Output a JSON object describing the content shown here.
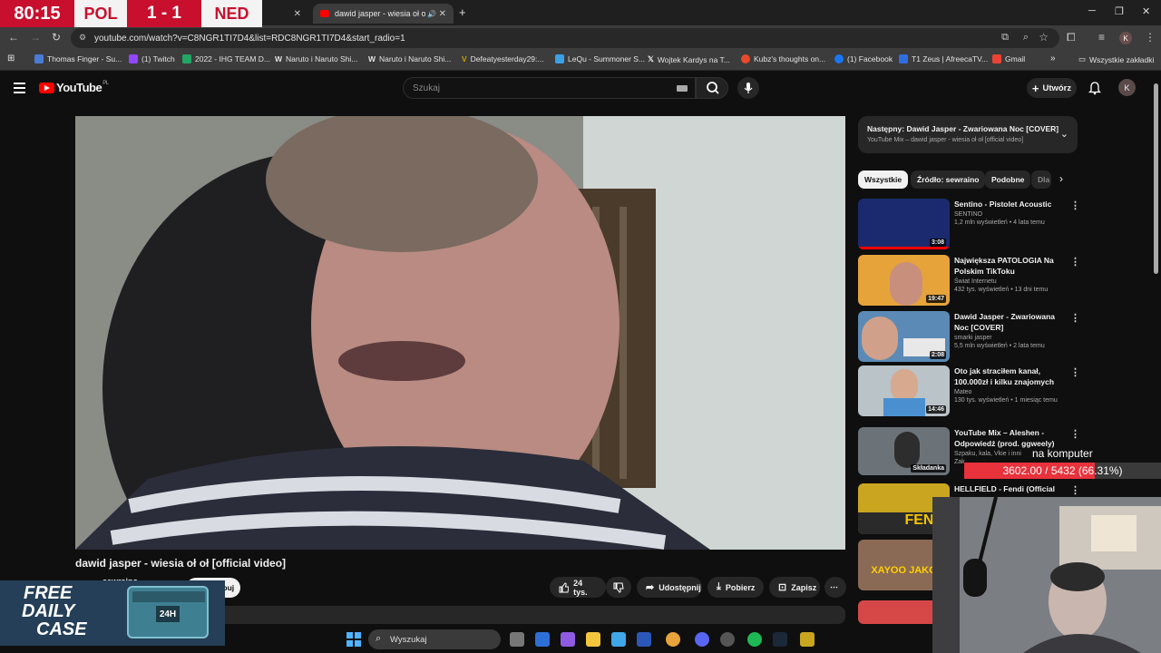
{
  "scoreboard": {
    "time": "80:15",
    "team1": "POL",
    "score": "1 - 1",
    "team2": "NED"
  },
  "browser": {
    "active_tab_title": "dawid jasper - wiesia oł oł |",
    "new_tab_label": "+",
    "url": "youtube.com/watch?v=C8NGR1TI7D4&list=RDC8NGR1TI7D4&start_radio=1",
    "bookmarks": [
      {
        "label": "Thomas Finger - Su...",
        "color": "#4a7bd6"
      },
      {
        "label": "(1) Twitch",
        "color": "#9146ff"
      },
      {
        "label": "2022 - IHG TEAM D...",
        "color": "#23a566"
      },
      {
        "label": "Naruto i Naruto Shi...",
        "color": "#ffffff"
      },
      {
        "label": "Naruto i Naruto Shi...",
        "color": "#ffffff"
      },
      {
        "label": "Defeatyesterday29:...",
        "color": "#c8a200"
      },
      {
        "label": "LeQu - Summoner S...",
        "color": "#3aa0e8"
      },
      {
        "label": "Wojtek Kardys na T...",
        "color": "#111111"
      },
      {
        "label": "Kubz's thoughts on...",
        "color": "#e84a2a"
      },
      {
        "label": "(1) Facebook",
        "color": "#1877f2"
      },
      {
        "label": "T1 Zeus | AfreecaTV...",
        "color": "#2f6ee0"
      },
      {
        "label": "Gmail",
        "color": "#ea4335"
      }
    ],
    "all_bookmarks_label": "Wszystkie zakładki"
  },
  "youtube": {
    "logo_text": "YouTube",
    "logo_region": "PL",
    "search_placeholder": "Szukaj",
    "create_label": "Utwórz",
    "avatar_letter": "K",
    "video_title": "dawid jasper - wiesia oł oł [official video]",
    "channel_name": "sewraino",
    "subscribe_label": "Subskrybuj",
    "actions": {
      "like_count": "24 tys.",
      "share": "Udostępnij",
      "download": "Pobierz",
      "save": "Zapisz"
    },
    "up_next": {
      "title": "Następny: Dawid Jasper - Zwariowana Noc [COVER]",
      "subtitle": "YouTube Mix – dawid jasper - wiesia oł oł [official video]"
    },
    "chips": [
      "Wszystkie",
      "Źródło: sewraino",
      "Podobne",
      "Dla"
    ],
    "related": [
      {
        "title": "Sentino - Pistolet Acoustic",
        "channel": "SENTINO",
        "meta": "1,2 mln wyświetleń • 4 lata temu",
        "duration": "3:08",
        "color": "#1b2a6e"
      },
      {
        "title": "Największa PATOLOGIA Na Polskim TikToku",
        "channel": "Świat Internetu",
        "meta": "432 tys. wyświetleń • 13 dni temu",
        "duration": "19:47",
        "color": "#e6a33a"
      },
      {
        "title": "Dawid Jasper - Zwariowana Noc [COVER]",
        "channel": "smarki jasper",
        "meta": "5,5 mln wyświetleń • 2 lata temu",
        "duration": "2:08",
        "color": "#5a8ab5"
      },
      {
        "title": "Oto jak straciłem kanał, 100.000zł i kilku znajomych",
        "channel": "Mateo",
        "meta": "130 tys. wyświetleń • 1 miesiąc temu",
        "duration": "14:46",
        "color": "#b9c3c8"
      },
      {
        "title": "YouTube Mix – Aleshen - Odpowiedź (prod. ggweely)",
        "channel": "Szpaku, kala, Vkie i inni",
        "meta": "Zak",
        "duration": "Składanka",
        "color": "#6c7378"
      },
      {
        "title": "HELLFIELD - Fendi (Official Video)",
        "channel": "",
        "meta": "",
        "duration": "",
        "color": "#c9a520"
      }
    ]
  },
  "overlays": {
    "stats_label": "na komputer",
    "stats_value": "3602.00 / 5432 (66.31%)",
    "stats_progress": 0.6631,
    "daily_case_line1": "FREE",
    "daily_case_line2": "DAILY",
    "daily_case_line3": "CASE",
    "daily_case_badge": "24H"
  },
  "taskbar": {
    "search_label": "Wyszukaj"
  }
}
